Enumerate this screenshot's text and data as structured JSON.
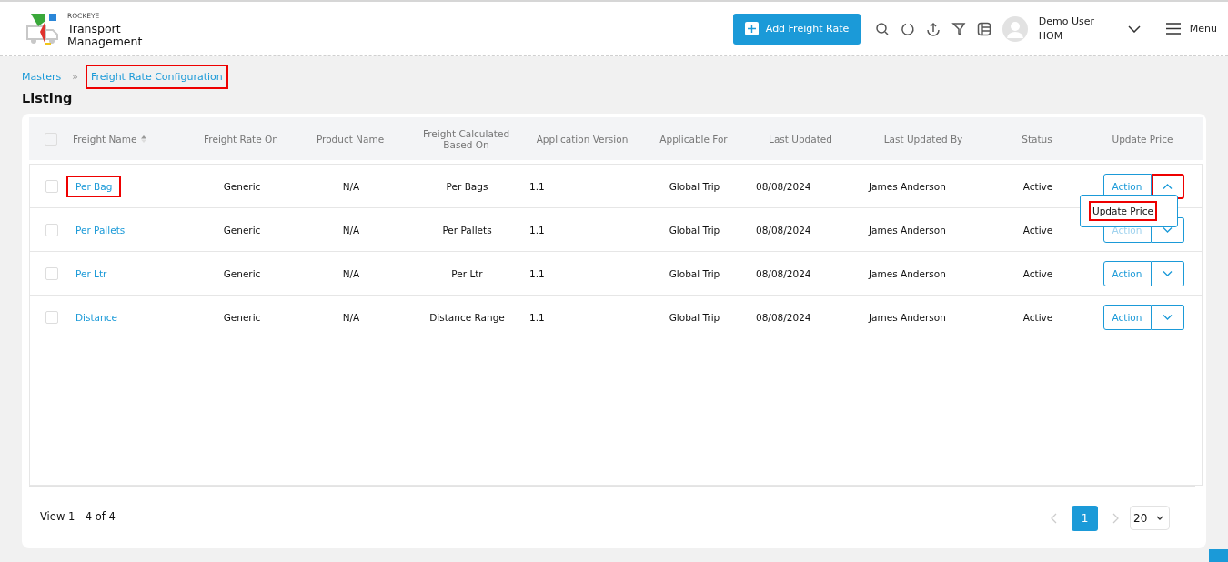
{
  "header": {
    "brand_small": "ROCKEYE",
    "brand": "Transport Management",
    "add_button": "Add Freight Rate",
    "user": {
      "name": "Demo User",
      "role": "HOM"
    },
    "menu": "Menu"
  },
  "breadcrumb": [
    {
      "label": "Masters",
      "highlighted": false
    },
    {
      "label": "Freight Rate Configuration",
      "highlighted": true
    }
  ],
  "breadcrumb_separator": "»",
  "page_title": "Listing",
  "table": {
    "columns": [
      {
        "label": "Freight Name",
        "sorted": true
      },
      {
        "label": "Freight Rate On"
      },
      {
        "label": "Product Name"
      },
      {
        "label": "Freight Calculated Based On"
      },
      {
        "label": "Application Version"
      },
      {
        "label": "Applicable For"
      },
      {
        "label": "Last Updated"
      },
      {
        "label": "Last Updated By"
      },
      {
        "label": "Status"
      },
      {
        "label": "Update Price"
      }
    ],
    "header_checked": false,
    "rows": [
      {
        "checked": false,
        "name": "Per Bag",
        "name_highlighted": true,
        "rate_on": "Generic",
        "product": "N/A",
        "calculated_on": "Per Bags",
        "version": "1.1",
        "applicable_for": "Global Trip",
        "last_updated": "08/08/2024",
        "updated_by": "James Anderson",
        "status": "Active",
        "action": "Action",
        "expanded": true,
        "toggle_highlighted": true,
        "menu": [
          {
            "label": "Update Price",
            "highlighted": true
          }
        ]
      },
      {
        "checked": false,
        "name": "Per Pallets",
        "name_highlighted": false,
        "rate_on": "Generic",
        "product": "N/A",
        "calculated_on": "Per Pallets",
        "version": "1.1",
        "applicable_for": "Global Trip",
        "last_updated": "08/08/2024",
        "updated_by": "James Anderson",
        "status": "Active",
        "action": "Action",
        "expanded": false,
        "toggle_highlighted": false
      },
      {
        "checked": false,
        "name": "Per Ltr",
        "name_highlighted": false,
        "rate_on": "Generic",
        "product": "N/A",
        "calculated_on": "Per Ltr",
        "version": "1.1",
        "applicable_for": "Global Trip",
        "last_updated": "08/08/2024",
        "updated_by": "James Anderson",
        "status": "Active",
        "action": "Action",
        "expanded": false,
        "toggle_highlighted": false
      },
      {
        "checked": false,
        "name": "Distance",
        "name_highlighted": false,
        "rate_on": "Generic",
        "product": "N/A",
        "calculated_on": "Distance Range",
        "version": "1.1",
        "applicable_for": "Global Trip",
        "last_updated": "08/08/2024",
        "updated_by": "James Anderson",
        "status": "Active",
        "action": "Action",
        "expanded": false,
        "toggle_highlighted": false
      }
    ]
  },
  "footer": {
    "summary": "View 1 - 4 of 4",
    "pages": [
      {
        "label": "1",
        "selected": true
      }
    ],
    "page_size": "20"
  }
}
